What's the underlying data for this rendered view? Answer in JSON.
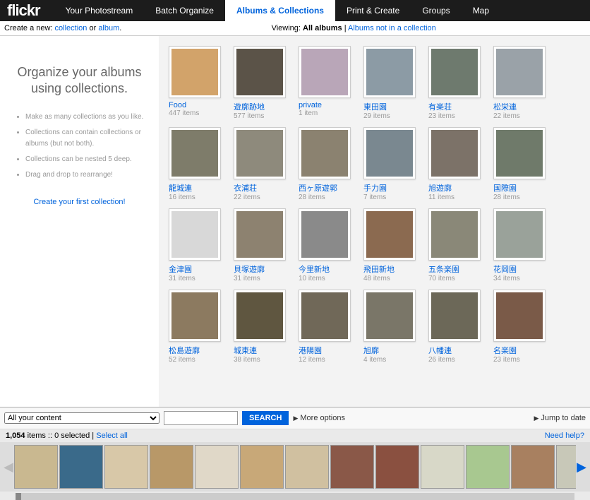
{
  "logo_text": "flickr",
  "nav": [
    "Your Photostream",
    "Batch Organize",
    "Albums & Collections",
    "Print & Create",
    "Groups",
    "Map"
  ],
  "nav_active_index": 2,
  "subbar": {
    "create_prefix": "Create a new: ",
    "create_collection": "collection",
    "create_or": " or ",
    "create_album": "album",
    "create_suffix": ".",
    "viewing_prefix": "Viewing: ",
    "viewing_bold": "All albums",
    "viewing_sep": " | ",
    "not_in_collection": "Albums not in a collection"
  },
  "sidebar": {
    "heading_l1": "Organize your albums",
    "heading_l2": "using collections.",
    "tips": [
      "Make as many collections as you like.",
      "Collections can contain collections or albums (but not both).",
      "Collections can be nested 5 deep.",
      "Drag and drop to rearrange!"
    ],
    "create_link": "Create your first collection!"
  },
  "albums": [
    {
      "title": "Food",
      "count": "447 items",
      "c": "#d2a36a"
    },
    {
      "title": "遊廓跡地",
      "count": "577 items",
      "c": "#5b5348"
    },
    {
      "title": "private",
      "count": "1 item",
      "c": "#b9a6b8"
    },
    {
      "title": "東田園",
      "count": "29 items",
      "c": "#8c9ba5"
    },
    {
      "title": "有楽荘",
      "count": "23 items",
      "c": "#6e7a6e"
    },
    {
      "title": "松栄連",
      "count": "22 items",
      "c": "#9aa2a8"
    },
    {
      "title": "龍城連",
      "count": "16 items",
      "c": "#7e7c6a"
    },
    {
      "title": "衣浦荘",
      "count": "22 items",
      "c": "#8e8a7c"
    },
    {
      "title": "西ヶ原遊郭",
      "count": "28 items",
      "c": "#8b8270"
    },
    {
      "title": "手力園",
      "count": "7 items",
      "c": "#7a8890"
    },
    {
      "title": "旭遊廓",
      "count": "11 items",
      "c": "#7c7268"
    },
    {
      "title": "国際園",
      "count": "28 items",
      "c": "#6f7a6a"
    },
    {
      "title": "金津園",
      "count": "31 items",
      "c": "#d8d8d8"
    },
    {
      "title": "貝塚遊廓",
      "count": "31 items",
      "c": "#8d8270"
    },
    {
      "title": "今里新地",
      "count": "10 items",
      "c": "#8a8a8a"
    },
    {
      "title": "飛田新地",
      "count": "48 items",
      "c": "#8b6a50"
    },
    {
      "title": "五条楽園",
      "count": "70 items",
      "c": "#8a8878"
    },
    {
      "title": "花岡園",
      "count": "34 items",
      "c": "#9aa29a"
    },
    {
      "title": "松島遊廓",
      "count": "52 items",
      "c": "#8c7a60"
    },
    {
      "title": "城東連",
      "count": "38 items",
      "c": "#5f5640"
    },
    {
      "title": "港陽園",
      "count": "12 items",
      "c": "#706858"
    },
    {
      "title": "旭廓",
      "count": "4 items",
      "c": "#7a7668"
    },
    {
      "title": "八幡連",
      "count": "26 items",
      "c": "#6c6858"
    },
    {
      "title": "名楽園",
      "count": "23 items",
      "c": "#7a5a48"
    }
  ],
  "bottom": {
    "content_filter": "All your content",
    "search_btn": "SEARCH",
    "more_options": "More options",
    "jump_to_date": "Jump to date",
    "status_count": "1,054",
    "status_items": " items :: ",
    "status_selected": "0 selected",
    "status_sep": " | ",
    "select_all": "Select all",
    "need_help": "Need help?"
  },
  "strip_colors": [
    "#c9b890",
    "#3a6a8a",
    "#d8c8a8",
    "#b89868",
    "#e0d8c8",
    "#c8a878",
    "#d0c0a0",
    "#8a5848",
    "#8a5040",
    "#d8d8c8",
    "#a8c890",
    "#a88060",
    "#c8c8b8"
  ]
}
